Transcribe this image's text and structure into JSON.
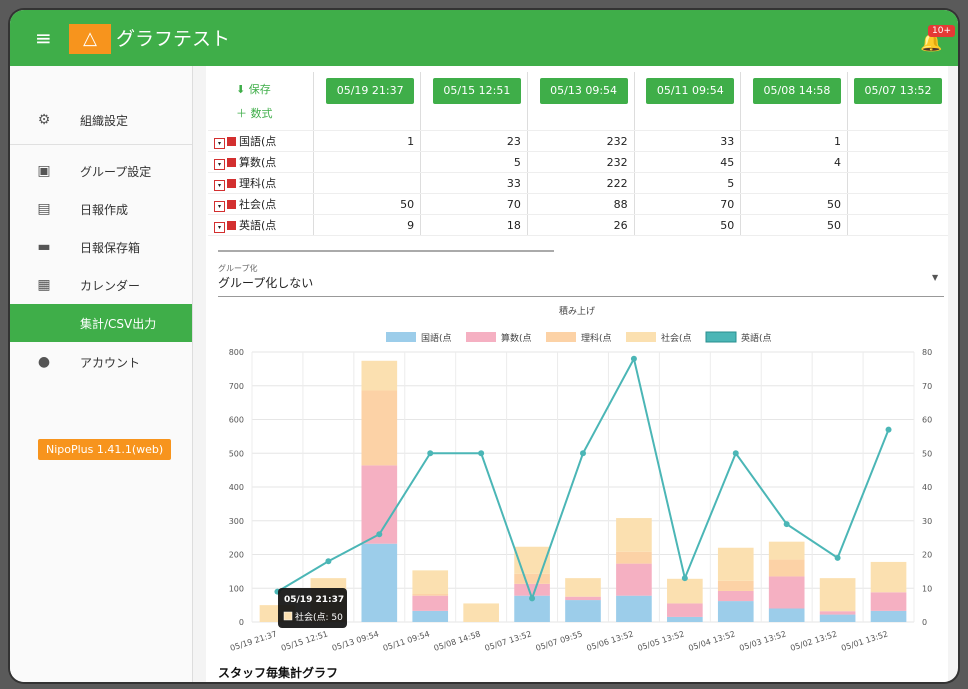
{
  "app": {
    "title": "グラフテスト",
    "notification_badge": "10+"
  },
  "sidebar": {
    "items": [
      {
        "label": "組織設定",
        "icon": "gear-icon"
      },
      {
        "label": "グループ設定",
        "icon": "group-settings-icon"
      },
      {
        "label": "日報作成",
        "icon": "file-add-icon"
      },
      {
        "label": "日報保存箱",
        "icon": "folder-icon"
      },
      {
        "label": "カレンダー",
        "icon": "calendar-icon"
      },
      {
        "label": "集計/CSV出力",
        "icon": "",
        "active": true
      },
      {
        "label": "アカウント",
        "icon": "account-icon"
      }
    ],
    "version": "NipoPlus 1.41.1(web)"
  },
  "table": {
    "save_label": "保存",
    "formula_label": "数式",
    "columns": [
      "05/19 21:37",
      "05/15 12:51",
      "05/13 09:54",
      "05/11 09:54",
      "05/08 14:58",
      "05/07 13:52"
    ],
    "rows": [
      {
        "label": "国語(点",
        "values": [
          "1",
          "23",
          "232",
          "33",
          "1",
          ""
        ]
      },
      {
        "label": "算数(点",
        "values": [
          "",
          "5",
          "232",
          "45",
          "4",
          ""
        ]
      },
      {
        "label": "理科(点",
        "values": [
          "",
          "33",
          "222",
          "5",
          "",
          ""
        ]
      },
      {
        "label": "社会(点",
        "values": [
          "50",
          "70",
          "88",
          "70",
          "50",
          ""
        ]
      },
      {
        "label": "英語(点",
        "values": [
          "9",
          "18",
          "26",
          "50",
          "50",
          ""
        ]
      }
    ]
  },
  "grouping": {
    "label": "グループ化",
    "value": "グループ化しない"
  },
  "staff_section": {
    "title": "スタッフ毎集計グラフ"
  },
  "tooltip": {
    "title": "05/19 21:37",
    "text": "社会(点: 50"
  },
  "chart_data": {
    "type": "bar",
    "title": "積み上げ",
    "categories": [
      "05/19 21:37",
      "05/15 12:51",
      "05/13 09:54",
      "05/11 09:54",
      "05/08 14:58",
      "05/07 13:52",
      "05/07 09:55",
      "05/06 13:52",
      "05/05 13:52",
      "05/04 13:52",
      "05/03 13:52",
      "05/02 13:52",
      "05/01 13:52"
    ],
    "series": [
      {
        "name": "国語(点",
        "color": "#9ccdea",
        "values": [
          0,
          0,
          232,
          33,
          0,
          78,
          65,
          78,
          15,
          62,
          40,
          22,
          33
        ]
      },
      {
        "name": "算数(点",
        "color": "#f5b0c2",
        "values": [
          0,
          0,
          232,
          45,
          0,
          35,
          10,
          95,
          40,
          30,
          95,
          10,
          55
        ]
      },
      {
        "name": "理科(点",
        "color": "#fcd2a6",
        "values": [
          0,
          35,
          222,
          5,
          0,
          30,
          0,
          35,
          0,
          30,
          50,
          0,
          0
        ]
      },
      {
        "name": "社会(点",
        "color": "#fbe0b0",
        "values": [
          50,
          95,
          88,
          70,
          55,
          80,
          55,
          100,
          73,
          98,
          53,
          98,
          90
        ]
      },
      {
        "name": "英語(点",
        "color": "#4bb6b6",
        "type": "line",
        "axis": "right",
        "values": [
          9,
          18,
          26,
          50,
          50,
          7,
          50,
          78,
          13,
          50,
          29,
          19,
          57
        ]
      }
    ],
    "yLeft": {
      "min": 0,
      "max": 800,
      "ticks": [
        0,
        100,
        200,
        300,
        400,
        500,
        600,
        700,
        800
      ]
    },
    "yRight": {
      "min": 0,
      "max": 80,
      "ticks": [
        0,
        10,
        20,
        30,
        40,
        50,
        60,
        70,
        80
      ]
    },
    "grid": true,
    "legend_position": "top"
  }
}
